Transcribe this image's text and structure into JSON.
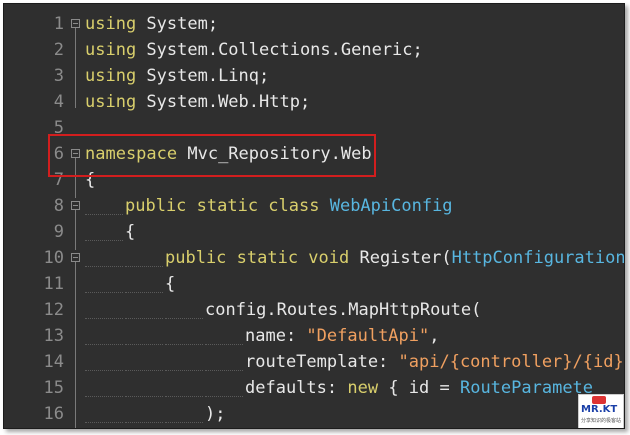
{
  "editor": {
    "lines": [
      {
        "num": "1",
        "tokens": [
          {
            "t": "kw",
            "v": "using"
          },
          {
            "t": "plain",
            "v": " System;"
          }
        ]
      },
      {
        "num": "2",
        "tokens": [
          {
            "t": "kw",
            "v": "using"
          },
          {
            "t": "plain",
            "v": " System.Collections.Generic;"
          }
        ]
      },
      {
        "num": "3",
        "tokens": [
          {
            "t": "kw",
            "v": "using"
          },
          {
            "t": "plain",
            "v": " System.Linq;"
          }
        ]
      },
      {
        "num": "4",
        "tokens": [
          {
            "t": "kw",
            "v": "using"
          },
          {
            "t": "plain",
            "v": " System.Web.Http;"
          }
        ]
      },
      {
        "num": "5",
        "tokens": []
      },
      {
        "num": "6",
        "tokens": [
          {
            "t": "kw",
            "v": "namespace"
          },
          {
            "t": "plain",
            "v": " Mvc_Repository.Web"
          }
        ]
      },
      {
        "num": "7",
        "tokens": [
          {
            "t": "plain",
            "v": "{"
          }
        ]
      },
      {
        "num": "8",
        "tokens": [
          {
            "t": "kw",
            "v": "public static class"
          },
          {
            "t": "plain",
            "v": " "
          },
          {
            "t": "ty",
            "v": "WebApiConfig"
          }
        ]
      },
      {
        "num": "9",
        "tokens": [
          {
            "t": "plain",
            "v": "{"
          }
        ]
      },
      {
        "num": "10",
        "tokens": [
          {
            "t": "kw",
            "v": "public static void"
          },
          {
            "t": "plain",
            "v": " Register("
          },
          {
            "t": "ty",
            "v": "HttpConfiguration"
          }
        ]
      },
      {
        "num": "11",
        "tokens": [
          {
            "t": "plain",
            "v": "{"
          }
        ]
      },
      {
        "num": "12",
        "tokens": [
          {
            "t": "plain",
            "v": "config.Routes.MapHttpRoute("
          }
        ]
      },
      {
        "num": "13",
        "tokens": [
          {
            "t": "plain",
            "v": "name: "
          },
          {
            "t": "str",
            "v": "\"DefaultApi\""
          },
          {
            "t": "plain",
            "v": ","
          }
        ]
      },
      {
        "num": "14",
        "tokens": [
          {
            "t": "plain",
            "v": "routeTemplate: "
          },
          {
            "t": "str",
            "v": "\"api/{controller}/{id}\""
          }
        ]
      },
      {
        "num": "15",
        "tokens": [
          {
            "t": "plain",
            "v": "defaults: "
          },
          {
            "t": "kw",
            "v": "new"
          },
          {
            "t": "plain",
            "v": " { id = "
          },
          {
            "t": "ty",
            "v": "RouteParamete"
          }
        ]
      },
      {
        "num": "16",
        "tokens": [
          {
            "t": "plain",
            "v": ");"
          }
        ]
      }
    ]
  },
  "watermark": {
    "brand": "MR.KT",
    "sub": "分享知识的极客站"
  },
  "colors": {
    "background": "#2f2f2f",
    "keyword": "#d9cf6c",
    "type": "#58b6e0",
    "string": "#f0a060",
    "plain": "#e8e8e8",
    "line_number": "#8b8b8b",
    "highlight": "#d21e1e"
  }
}
